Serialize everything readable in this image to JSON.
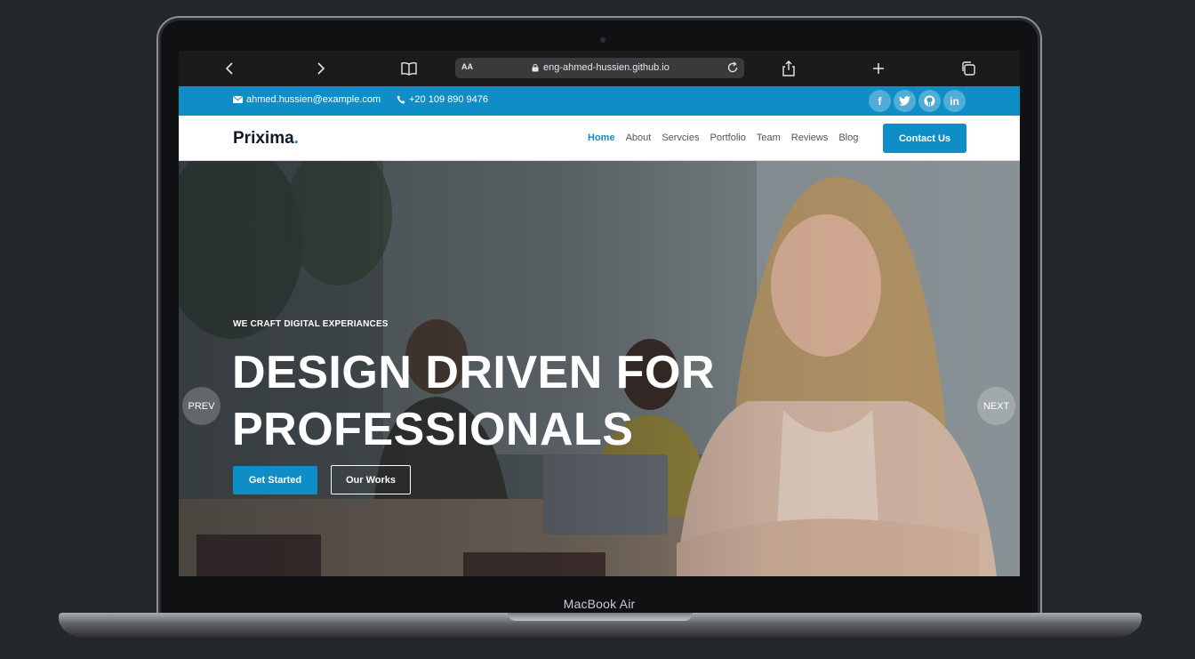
{
  "device": {
    "label": "MacBook Air"
  },
  "browser": {
    "reader_label": "AA",
    "url": "eng-ahmed-hussien.github.io",
    "icons": [
      "back-icon",
      "forward-icon",
      "bookmarks-icon",
      "lock-icon",
      "reload-icon",
      "share-icon",
      "new-tab-icon",
      "tabs-icon"
    ]
  },
  "topbar": {
    "email": "ahmed.hussien@example.com",
    "phone": "+20 109 890 9476",
    "socials": [
      {
        "name": "facebook-icon",
        "glyph": "f"
      },
      {
        "name": "twitter-icon",
        "glyph": "t"
      },
      {
        "name": "github-icon",
        "glyph": "g"
      },
      {
        "name": "linkedin-icon",
        "glyph": "in"
      }
    ],
    "color": "#0f8dc6"
  },
  "nav": {
    "logo": "Prixima",
    "logo_dot": ".",
    "links": [
      "Home",
      "About",
      "Servcies",
      "Portfolio",
      "Team",
      "Reviews",
      "Blog"
    ],
    "active": "Home",
    "cta": "Contact Us"
  },
  "hero": {
    "eyebrow": "WE CRAFT DIGITAL EXPERIANCES",
    "headline_line1": "DESIGN DRIVEN FOR",
    "headline_line2": "PROFESSIONALS",
    "primary_button": "Get Started",
    "secondary_button": "Our Works",
    "prev": "PREV",
    "next": "NEXT"
  }
}
